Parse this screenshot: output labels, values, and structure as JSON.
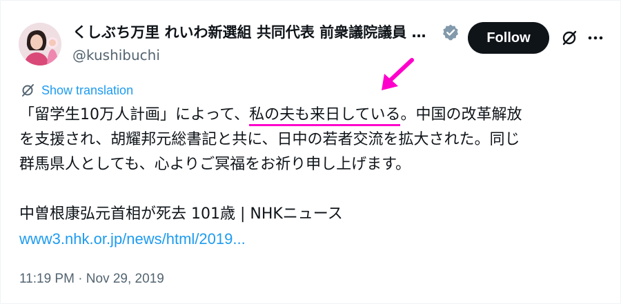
{
  "author": {
    "display_name": "くしぶち万里 れいわ新選組 共同代表 前衆議院議員 政策審議会長",
    "handle": "@kushibuchi",
    "verified": true
  },
  "actions": {
    "follow_label": "Follow",
    "grok_icon": "grok-icon",
    "more_icon": "more-icon"
  },
  "translation": {
    "label": "Show translation"
  },
  "tweet": {
    "line1_pre": "「留学生10万人計画」によって、",
    "line1_highlight": "私の夫も来日している",
    "line1_post": "。中国の改革解放",
    "line2": "を支援され、胡耀邦元総書記と共に、日中の若者交流を拡大された。同じ",
    "line3": "群馬県人としても、心よりご冥福をお祈り申し上げます。",
    "headline": "中曽根康弘元首相が死去 101歳 | NHKニュース",
    "link": "www3.nhk.or.jp/news/html/2019..."
  },
  "timestamp": "11:19 PM · Nov 29, 2019",
  "colors": {
    "accent": "#1d9bf0",
    "annotation": "#ff00cc",
    "follow_bg": "#0f1419"
  }
}
